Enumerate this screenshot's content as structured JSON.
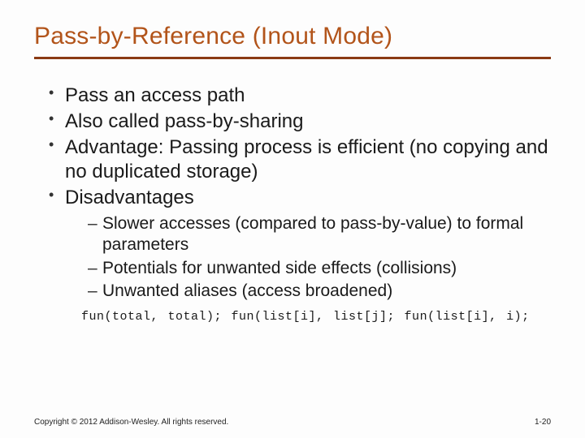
{
  "title": "Pass-by-Reference (Inout Mode)",
  "bullets": {
    "b1": "Pass an access path",
    "b2": "Also called pass-by-sharing",
    "b3": "Advantage: Passing process is efficient (no copying and no duplicated storage)",
    "b4": "Disadvantages",
    "sub1": "Slower accesses (compared to pass-by-value) to formal parameters",
    "sub2": "Potentials for unwanted side effects (collisions)",
    "sub3": "Unwanted aliases (access broadened)"
  },
  "code": "fun(total, total);  fun(list[i], list[j];  fun(list[i], i);",
  "footer": {
    "copyright": "Copyright © 2012 Addison-Wesley. All rights reserved.",
    "pagenum": "1-20"
  }
}
